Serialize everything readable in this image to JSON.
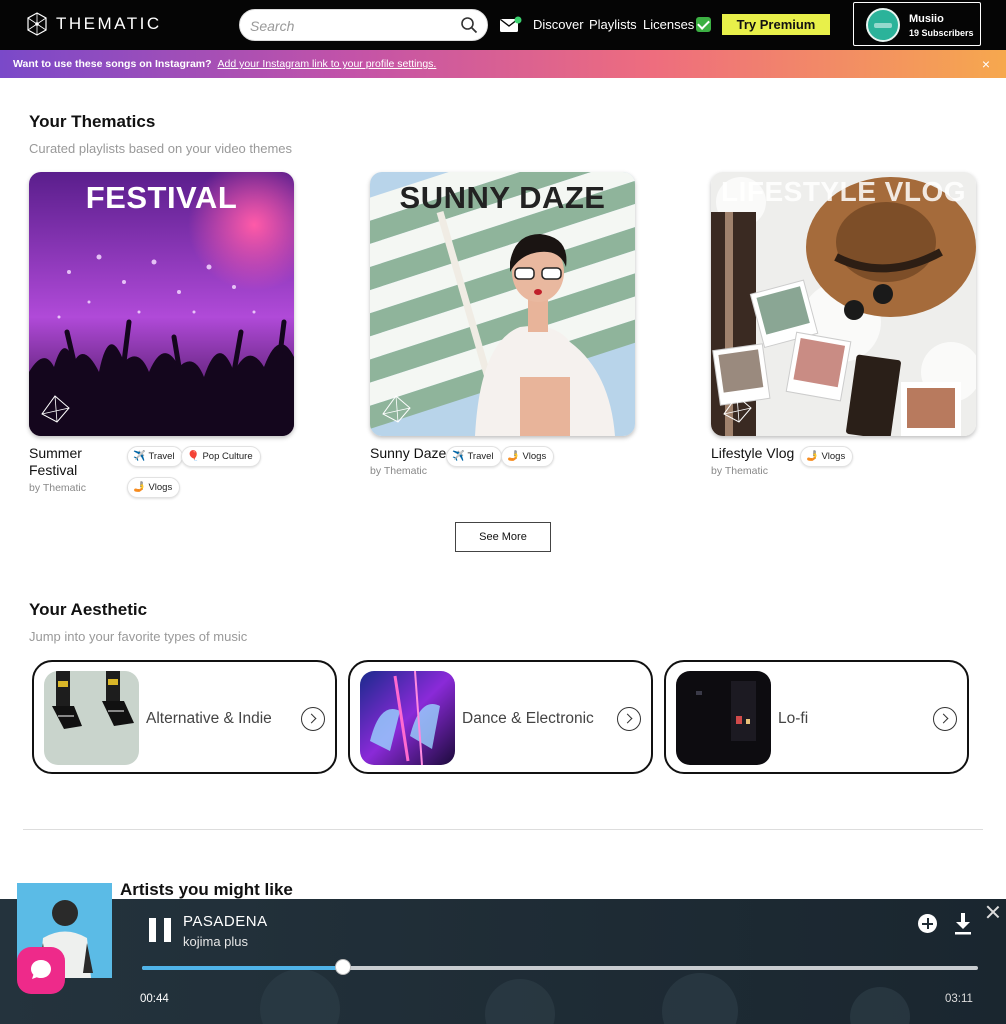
{
  "header": {
    "logo_text": "THEMATIC",
    "search_placeholder": "Search",
    "nav": {
      "discover": "Discover",
      "playlists": "Playlists",
      "licenses": "Licenses"
    },
    "premium_label": "Try Premium",
    "profile": {
      "name": "Musiio",
      "subscribers": "19 Subscribers"
    }
  },
  "banner": {
    "text": "Want to use these songs on Instagram?",
    "link": "Add your Instagram link to your profile settings.",
    "close": "×"
  },
  "thematics": {
    "title": "Your Thematics",
    "subtitle": "Curated playlists based on your video themes",
    "cards": [
      {
        "image_text": "FESTIVAL",
        "title": "Summer Festival",
        "author": "by Thematic",
        "tags": [
          {
            "icon": "✈️",
            "label": "Travel"
          },
          {
            "icon": "🎈",
            "label": "Pop Culture"
          },
          {
            "icon": "🤳",
            "label": "Vlogs"
          }
        ]
      },
      {
        "image_text": "SUNNY DAZE",
        "title": "Sunny Daze",
        "author": "by Thematic",
        "tags": [
          {
            "icon": "✈️",
            "label": "Travel"
          },
          {
            "icon": "🤳",
            "label": "Vlogs"
          }
        ]
      },
      {
        "image_text": "LIFESTYLE VLOG",
        "title": "Lifestyle Vlog",
        "author": "by Thematic",
        "tags": [
          {
            "icon": "🤳",
            "label": "Vlogs"
          }
        ]
      }
    ],
    "see_more": "See More"
  },
  "aesthetic": {
    "title": "Your Aesthetic",
    "subtitle": "Jump into your favorite types of music",
    "items": [
      {
        "label": "Alternative & Indie"
      },
      {
        "label": "Dance & Electronic"
      },
      {
        "label": "Lo-fi"
      }
    ]
  },
  "next_section": {
    "title": "Artists you might like"
  },
  "player": {
    "title": "PASADENA",
    "artist": "kojima plus",
    "current_time": "00:44",
    "total_time": "03:11",
    "progress": 0.24
  }
}
